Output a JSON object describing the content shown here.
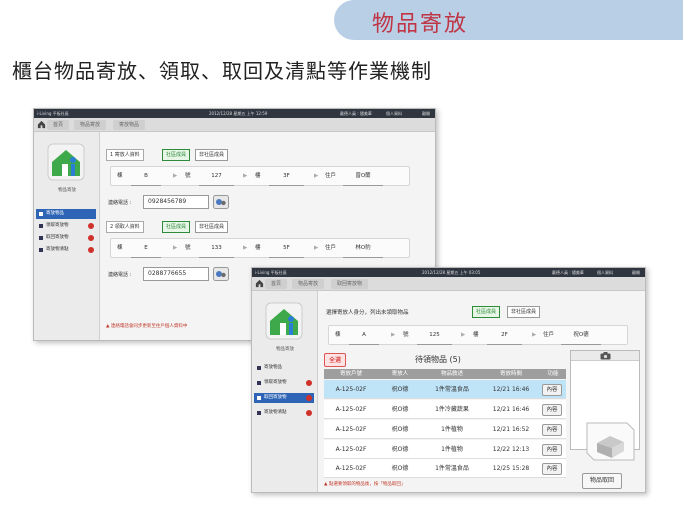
{
  "slide": {
    "title": "物品寄放",
    "subtitle": "櫃台物品寄放、領取、取回及清點等作業機制"
  },
  "colors": {
    "tab": "#b9cfe6",
    "title": "#c03545",
    "sidebar_active": "#2d64b5",
    "selected_row": "#bfe3f7"
  },
  "win1": {
    "app_name": "i-Living 平板社區",
    "datetime": "2012/12/28 星期五 上午 12:59",
    "header_right": "戴德人員 : 隨美華",
    "header_personal": "個人資料",
    "header_exit": "離開",
    "crumbs": [
      "首頁",
      "物品寄放",
      "寄放物品"
    ],
    "sidebar": {
      "caption": "物品寄放",
      "items": [
        {
          "label": "寄放物品"
        },
        {
          "label": "領取寄放物"
        },
        {
          "label": "取回寄放物"
        },
        {
          "label": "寄放物清點"
        }
      ]
    },
    "depositor": {
      "section": "寄放人資料",
      "step": "1",
      "member": "社區成員",
      "nonmember": "非社區成員",
      "building_label": "棟",
      "building": "B",
      "number_label": "號",
      "number": "127",
      "floor_label": "樓",
      "floor": "3F",
      "household_label": "住戶",
      "household": "曾O蘭",
      "phone_label": "連絡電話 :",
      "phone": "0928456789"
    },
    "receiver": {
      "section": "領取人資料",
      "step": "2",
      "member": "社區成員",
      "nonmember": "非社區成員",
      "building_label": "棟",
      "building": "E",
      "number_label": "號",
      "number": "133",
      "floor_label": "樓",
      "floor": "5F",
      "household_label": "住戶",
      "household": "林O豹",
      "phone_label": "連絡電話 :",
      "phone": "0288776655"
    },
    "warning": "連絡電話會同步更新至住戶個人資料中"
  },
  "win2": {
    "app_name": "i-Living 平板社區",
    "datetime": "2012/12/28 星期五 上午 03:05",
    "header_right": "戴德人員 : 隨美華",
    "header_personal": "個人資料",
    "header_exit": "離開",
    "crumbs": [
      "首頁",
      "物品寄放",
      "取回寄放物"
    ],
    "sidebar": {
      "caption": "物品寄放",
      "items": [
        {
          "label": "寄放物品"
        },
        {
          "label": "領取寄放物"
        },
        {
          "label": "取回寄放物"
        },
        {
          "label": "寄放物清點"
        }
      ]
    },
    "instruction": "選擇寄放人身分，列出未領取物品",
    "member": "社區成員",
    "nonmember": "非社區成員",
    "building_label": "棟",
    "building": "A",
    "number_label": "號",
    "number": "125",
    "floor_label": "樓",
    "floor": "2F",
    "household_label": "住戶",
    "household": "祝O德",
    "select_all": "全選",
    "grid_title": "待領物品 (5)",
    "columns": [
      "寄放戶號",
      "寄放人",
      "物品敘述",
      "寄放時間",
      "功能"
    ],
    "rows": [
      {
        "unit": "A-125-02F",
        "person": "祝O德",
        "desc": "1件常溫食品",
        "time": "12/21 16:46",
        "action": "內容",
        "selected": true
      },
      {
        "unit": "A-125-02F",
        "person": "祝O德",
        "desc": "1件冷藏蔬果",
        "time": "12/21 16:46",
        "action": "內容",
        "selected": false
      },
      {
        "unit": "A-125-02F",
        "person": "祝O德",
        "desc": "1件植物",
        "time": "12/21 16:52",
        "action": "內容",
        "selected": false
      },
      {
        "unit": "A-125-02F",
        "person": "祝O德",
        "desc": "1件植物",
        "time": "12/22 12:13",
        "action": "內容",
        "selected": false
      },
      {
        "unit": "A-125-02F",
        "person": "祝O德",
        "desc": "1件常溫食品",
        "time": "12/25 15:28",
        "action": "內容",
        "selected": false
      }
    ],
    "footer_note": "點選要領取的物品後，按「物品取回」",
    "pickup_button": "物品取回"
  }
}
